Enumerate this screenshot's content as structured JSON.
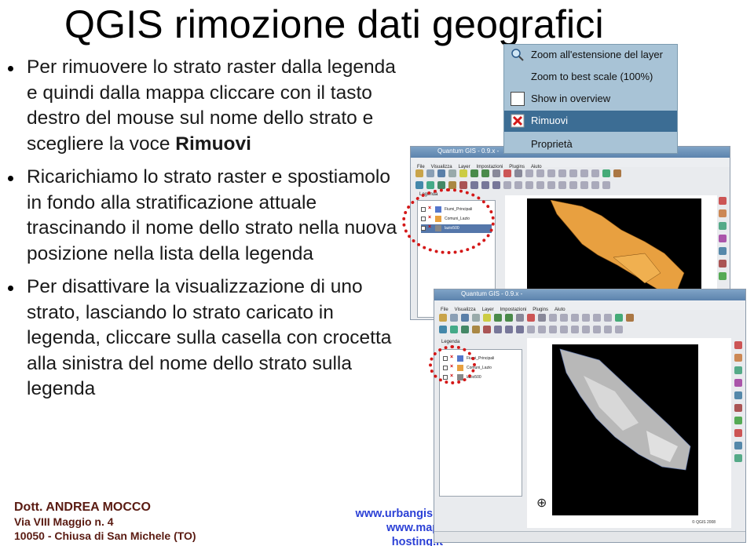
{
  "title": "QGIS rimozione dati geografici",
  "bullets": [
    {
      "text": "Per rimuovere lo strato raster dalla legenda e quindi dalla mappa cliccare con il tasto destro del mouse sul nome dello strato e scegliere la voce ",
      "bold": "Rimuovi"
    },
    {
      "text": "Ricarichiamo lo strato raster e spostiamolo in fondo alla stratificazione attuale trascinando il nome dello strato nella nuova posizione nella lista della legenda",
      "bold": ""
    },
    {
      "text": "Per disattivare la visualizzazione di uno strato, lasciando lo strato caricato in legenda, cliccare sulla casella con crocetta alla sinistra del nome dello strato sulla legenda",
      "bold": ""
    }
  ],
  "footer": {
    "name": "Dott. ANDREA MOCCO",
    "address1": "Via VIII Maggio n. 4",
    "address2": "10050 - Chiusa di San Michele (TO)",
    "link1": "www.urbangis.it",
    "link2": "www.map-hosting.it"
  },
  "context_menu": {
    "items": [
      {
        "label": "Zoom all'estensione del layer",
        "icon": "zoom-layer-icon",
        "selected": false
      },
      {
        "label": "Zoom to best scale (100%)",
        "icon": "",
        "selected": false
      },
      {
        "label": "Show in overview",
        "icon": "checkbox-icon",
        "selected": false
      },
      {
        "label": "Rimuovi",
        "icon": "remove-icon",
        "selected": true
      },
      {
        "label": "Proprietà",
        "icon": "",
        "selected": false
      }
    ]
  },
  "window1": {
    "title": "Quantum GIS - 0.9.x - ",
    "menu": [
      "File",
      "Visualizza",
      "Layer",
      "Impostazioni",
      "Plugins",
      "Aiuto"
    ],
    "legend_title": "Legenda",
    "layers": [
      "Fiumi_Principali",
      "Comuni_Lazio",
      "lazio500"
    ],
    "colors": {
      "map_fill": "#e8a040",
      "map_bg": "#000000"
    }
  },
  "window2": {
    "title": "Quantum GIS - 0.9.x - ",
    "menu": [
      "File",
      "Visualizza",
      "Layer",
      "Impostazioni",
      "Plugins",
      "Aiuto"
    ],
    "legend_title": "Legenda",
    "layers": [
      "Fiumi_Principali",
      "Comuni_Lazio",
      "lazio500"
    ],
    "copyright": "© QGIS 2008",
    "colors": {
      "map_fill": "#bdbdbd",
      "map_bg": "#000000"
    }
  },
  "colors": {
    "footer_name": "#5a1b12",
    "footer_link": "#2c41d6",
    "highlight_circle": "#d41818",
    "menu_bg": "#a8c3d6",
    "menu_selected": "#3c6d94"
  }
}
